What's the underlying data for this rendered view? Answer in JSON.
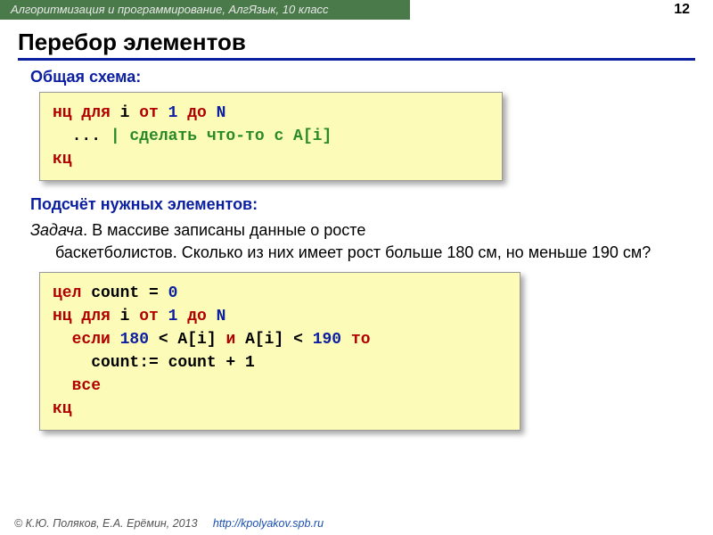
{
  "banner": "Алгоритмизация и программирование, АлгЯзык, 10 класс",
  "page_number": "12",
  "title": "Перебор элементов",
  "section1_heading": "Общая схема:",
  "section2_heading": "Подсчёт нужных элементов:",
  "task_label": "Задача",
  "task_text": ". В массиве записаны данные о росте баскетболистов. Сколько из них имеет рост больше 180 см, но меньше 190 см?",
  "code1": {
    "l1_kw": "нц для",
    "l1_var": " i ",
    "l1_kw2": "от ",
    "l1_n1": "1",
    "l1_kw3": " до ",
    "l1_n2": "N",
    "l2_lead": "  ... ",
    "l2_comment": "| сделать что-то с A[i]",
    "l3": "кц"
  },
  "code2": {
    "l1_kw": "цел",
    "l1_rest_a": " count = ",
    "l1_num": "0",
    "l2_kw": "нц для",
    "l2_var": " i ",
    "l2_kw2": "от ",
    "l2_n1": "1",
    "l2_kw3": " до ",
    "l2_n2": "N",
    "l3_pad": "  ",
    "l3_kw": "если ",
    "l3_n1": "180",
    "l3_mid1": " < A[i] ",
    "l3_kw2": "и",
    "l3_mid2": " A[i] < ",
    "l3_n2": "190",
    "l3_kw3": " то",
    "l4": "    count:= count + 1",
    "l5_pad": "  ",
    "l5_kw": "все",
    "l6": "кц"
  },
  "footer_copyright": "© К.Ю. Поляков, Е.А. Ерёмин, 2013",
  "footer_url": "http://kpolyakov.spb.ru"
}
